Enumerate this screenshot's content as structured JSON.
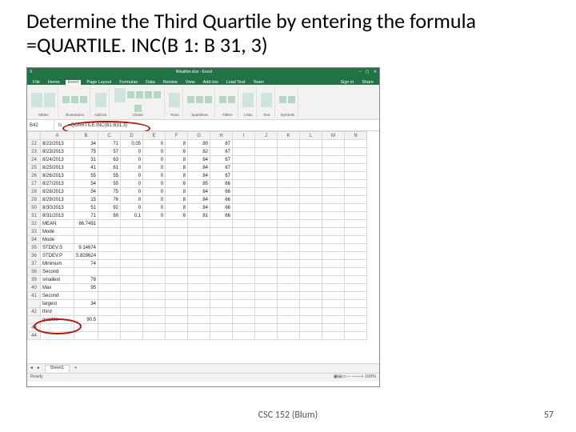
{
  "title_line": "Determine the Third Quartile by entering the formula =QUARTILE. INC(B 1: B 31, 3)",
  "footer": {
    "center": "CSC 152 (Blum)",
    "page": "57"
  },
  "excel": {
    "window_title": "Weather.xlsx - Excel",
    "winbtns": {
      "min": "–",
      "max": "▢",
      "close": "✕"
    },
    "tabs": [
      "File",
      "Home",
      "Insert",
      "Page Layout",
      "Formulas",
      "Data",
      "Review",
      "View",
      "Add-Ins",
      "Load Test",
      "Team"
    ],
    "active_tab_index": 2,
    "right_tabs": {
      "signin": "Sign in",
      "share": "Share"
    },
    "ribbon_groups": [
      "Tables",
      "Illustrations",
      "Add-ins",
      "Charts",
      "Tours",
      "Sparklines",
      "Filters",
      "Links",
      "Text",
      "Symbols"
    ],
    "namebox": "B42",
    "fx": "fx",
    "formula": "=QUARTILE.INC(B1:B31,3)",
    "columns": [
      "A",
      "B",
      "C",
      "D",
      "E",
      "F",
      "G",
      "H",
      "I",
      "J",
      "K",
      "L",
      "M",
      "N"
    ],
    "rows": [
      {
        "n": "22",
        "c": [
          "8/22/2013",
          "34",
          "71",
          "0.05",
          "0",
          "8",
          "80",
          "87",
          "",
          "",
          "",
          "",
          "",
          ""
        ]
      },
      {
        "n": "23",
        "c": [
          "8/23/2013",
          "75",
          "57",
          "0",
          "0",
          "8",
          "82",
          "67",
          "",
          "",
          "",
          "",
          "",
          ""
        ]
      },
      {
        "n": "24",
        "c": [
          "8/24/2013",
          "31",
          "63",
          "0",
          "0",
          "8",
          "84",
          "67",
          "",
          "",
          "",
          "",
          "",
          ""
        ]
      },
      {
        "n": "25",
        "c": [
          "8/25/2013",
          "41",
          "61",
          "0",
          "0",
          "8",
          "84",
          "67",
          "",
          "",
          "",
          "",
          "",
          ""
        ]
      },
      {
        "n": "26",
        "c": [
          "8/26/2013",
          "55",
          "55",
          "0",
          "0",
          "8",
          "84",
          "67",
          "",
          "",
          "",
          "",
          "",
          ""
        ]
      },
      {
        "n": "27",
        "c": [
          "8/27/2013",
          "54",
          "55",
          "0",
          "0",
          "8",
          "85",
          "66",
          "",
          "",
          "",
          "",
          "",
          ""
        ]
      },
      {
        "n": "28",
        "c": [
          "8/28/2013",
          "54",
          "75",
          "0",
          "0",
          "8",
          "84",
          "66",
          "",
          "",
          "",
          "",
          "",
          ""
        ]
      },
      {
        "n": "29",
        "c": [
          "8/29/2013",
          "15",
          "76",
          "0",
          "0",
          "8",
          "84",
          "66",
          "",
          "",
          "",
          "",
          "",
          ""
        ]
      },
      {
        "n": "30",
        "c": [
          "8/30/2013",
          "51",
          "92",
          "0",
          "0",
          "8",
          "84",
          "66",
          "",
          "",
          "",
          "",
          "",
          ""
        ]
      },
      {
        "n": "31",
        "c": [
          "8/31/2013",
          "71",
          "69",
          "0.1",
          "0",
          "8",
          "81",
          "66",
          "",
          "",
          "",
          "",
          "",
          ""
        ]
      },
      {
        "n": "32",
        "c": [
          "MEAN",
          "86.7491",
          "",
          "",
          "",
          "",
          "",
          "",
          "",
          "",
          "",
          "",
          "",
          ""
        ]
      },
      {
        "n": "33",
        "c": [
          "Mode",
          "",
          "",
          "",
          "",
          "",
          "",
          "",
          "",
          "",
          "",
          "",
          "",
          ""
        ]
      },
      {
        "n": "34",
        "c": [
          "Mode",
          "",
          "",
          "",
          "",
          "",
          "",
          "",
          "",
          "",
          "",
          "",
          "",
          ""
        ]
      },
      {
        "n": "35",
        "c": [
          "STDEV.S",
          "9.14674",
          "",
          "",
          "",
          "",
          "",
          "",
          "",
          "",
          "",
          "",
          "",
          ""
        ]
      },
      {
        "n": "36",
        "c": [
          "STDEV.P",
          "5.829624",
          "",
          "",
          "",
          "",
          "",
          "",
          "",
          "",
          "",
          "",
          "",
          ""
        ]
      },
      {
        "n": "37",
        "c": [
          "Minimum",
          "74",
          "",
          "",
          "",
          "",
          "",
          "",
          "",
          "",
          "",
          "",
          "",
          ""
        ]
      },
      {
        "n": "38",
        "c": [
          "Second",
          "",
          "",
          "",
          "",
          "",
          "",
          "",
          "",
          "",
          "",
          "",
          "",
          ""
        ]
      },
      {
        "n": "39",
        "c": [
          "smallest",
          "78",
          "",
          "",
          "",
          "",
          "",
          "",
          "",
          "",
          "",
          "",
          "",
          ""
        ]
      },
      {
        "n": "40",
        "c": [
          "Max",
          "95",
          "",
          "",
          "",
          "",
          "",
          "",
          "",
          "",
          "",
          "",
          "",
          ""
        ]
      },
      {
        "n": "41",
        "c": [
          "Second",
          "",
          "",
          "",
          "",
          "",
          "",
          "",
          "",
          "",
          "",
          "",
          "",
          ""
        ],
        "sub": "largest",
        "subv": "34"
      },
      {
        "n": "42",
        "c": [
          "third",
          "",
          "",
          "",
          "",
          "",
          "",
          "",
          "",
          "",
          "",
          "",
          "",
          ""
        ],
        "sub": "quartile",
        "subv": "90.5"
      },
      {
        "n": "43",
        "c": [
          "",
          "",
          "",
          "",
          "",
          "",
          "",
          "",
          "",
          "",
          "",
          "",
          "",
          ""
        ]
      },
      {
        "n": "44",
        "c": [
          "",
          "",
          "",
          "",
          "",
          "",
          "",
          "",
          "",
          "",
          "",
          "",
          "",
          ""
        ]
      }
    ],
    "sheet_tab": "Sheet1",
    "plus": "+",
    "ready": "Ready",
    "zoom": "+ 100%"
  }
}
